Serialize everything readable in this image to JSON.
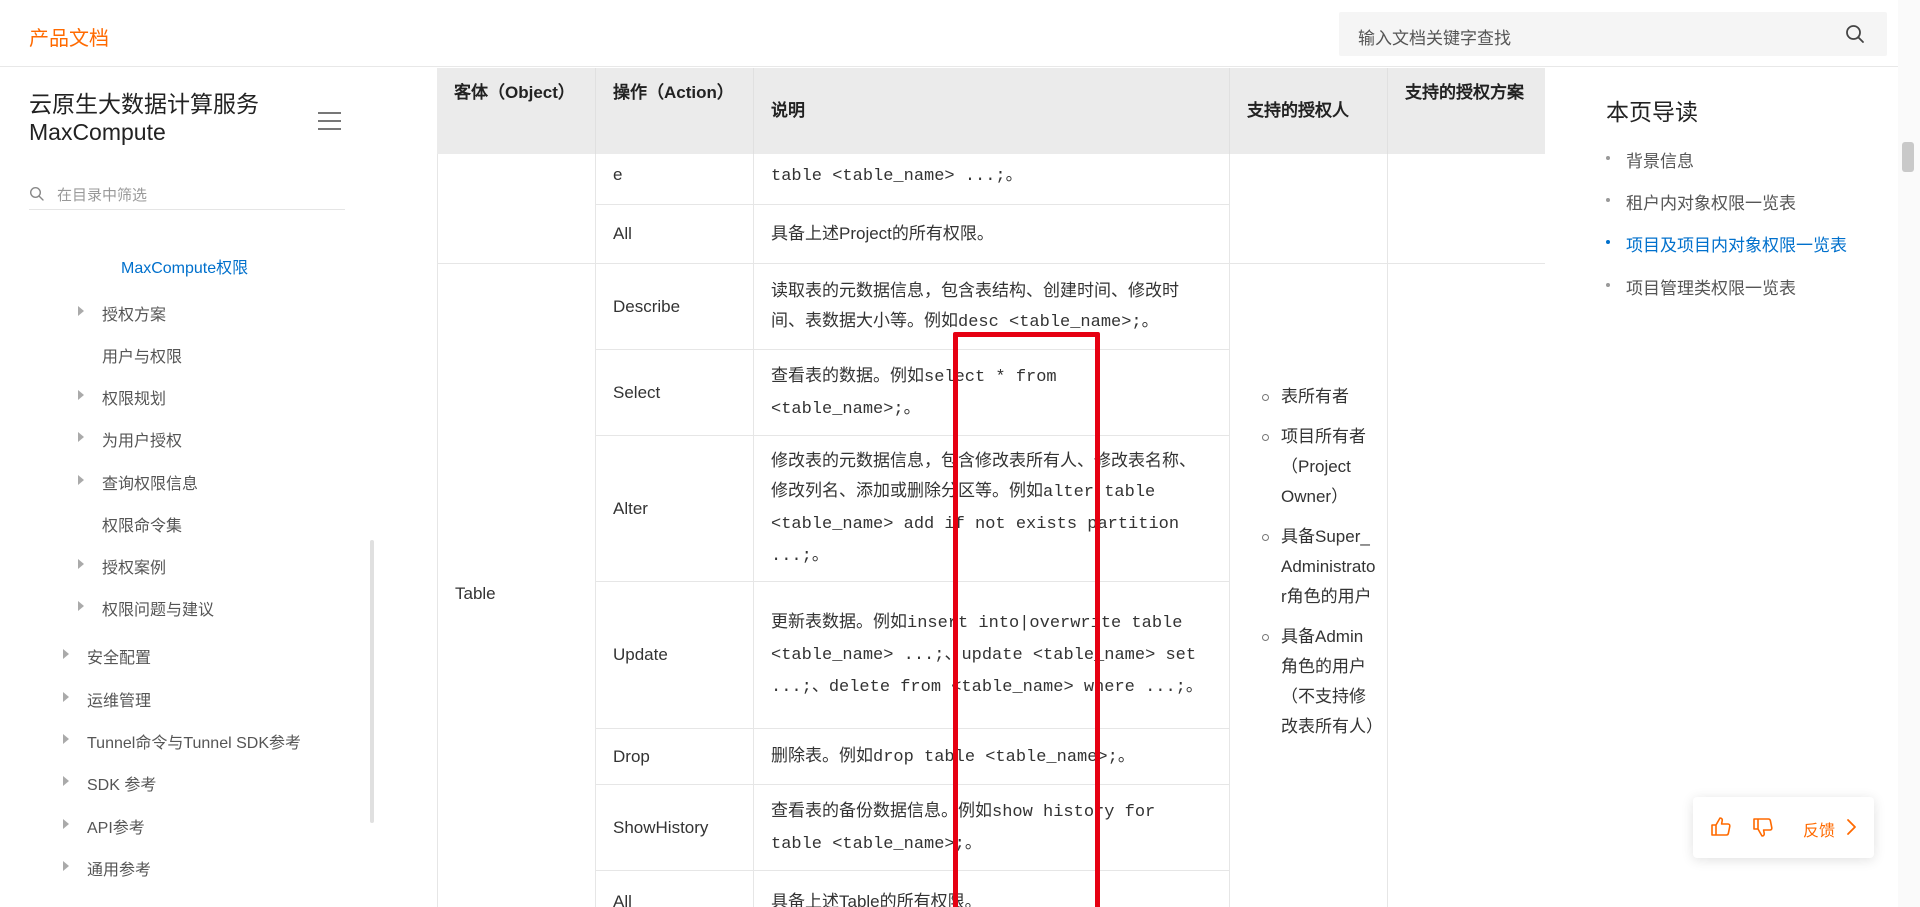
{
  "header": {
    "brand": "产品文档",
    "search_placeholder": "输入文档关键字查找"
  },
  "sidebar": {
    "title_line1": "云原生大数据计算服务",
    "title_line2": "MaxCompute",
    "filter_placeholder": "在目录中筛选",
    "items": [
      {
        "label": "MaxCompute权限",
        "active": true,
        "expandable": false
      },
      {
        "label": "授权方案",
        "active": false,
        "expandable": true
      },
      {
        "label": "用户与权限",
        "active": false,
        "expandable": false
      },
      {
        "label": "权限规划",
        "active": false,
        "expandable": true
      },
      {
        "label": "为用户授权",
        "active": false,
        "expandable": true
      },
      {
        "label": "查询权限信息",
        "active": false,
        "expandable": true
      },
      {
        "label": "权限命令集",
        "active": false,
        "expandable": false
      },
      {
        "label": "授权案例",
        "active": false,
        "expandable": true
      },
      {
        "label": "权限问题与建议",
        "active": false,
        "expandable": true
      },
      {
        "label": "安全配置",
        "active": false,
        "expandable": true
      },
      {
        "label": "运维管理",
        "active": false,
        "expandable": true
      },
      {
        "label": "Tunnel命令与Tunnel SDK参考",
        "active": false,
        "expandable": true
      },
      {
        "label": "SDK 参考",
        "active": false,
        "expandable": true
      },
      {
        "label": "API参考",
        "active": false,
        "expandable": true
      },
      {
        "label": "通用参考",
        "active": false,
        "expandable": true
      }
    ]
  },
  "table": {
    "headers": {
      "object": "客体（Object）",
      "action": "操作（Action）",
      "desc": "说明",
      "grantee": "支持的授权人",
      "scheme": "支持的授权方案"
    },
    "partial_row": {
      "action": "e",
      "desc_mono": "table <table_name> ...;",
      "desc_tail": "。"
    },
    "project_all": {
      "action": "All",
      "desc": "具备上述Project的所有权限。"
    },
    "table_object": "Table",
    "rows": [
      {
        "action": "Describe",
        "desc_text": "读取表的元数据信息，包含表结构、创建时间、修改时间、表数据大小等。例如",
        "desc_mono": "desc <table_name>;",
        "desc_tail": "。"
      },
      {
        "action": "Select",
        "desc_text": "查看表的数据。例如",
        "desc_mono": "select * from <table_name>;",
        "desc_tail": "。"
      },
      {
        "action": "Alter",
        "desc_text": "修改表的元数据信息，包含修改表所有人、修改表名称、修改列名、添加或删除分区等。例如",
        "desc_mono": "alter table <table_name> add if not exists partition ...;",
        "desc_tail": "。"
      },
      {
        "action": "Update",
        "desc_text": "更新表数据。例如",
        "desc_mono": "insert into|overwrite table <table_name> ...;",
        "desc_mid1": "、",
        "desc_mono2": "update <table_name> set ...;",
        "desc_mid2": "、",
        "desc_mono3": "delete from <table_name> where ...;",
        "desc_tail": "。"
      },
      {
        "action": "Drop",
        "desc_text": "删除表。例如",
        "desc_mono": "drop table <table_name>;",
        "desc_tail": "。"
      },
      {
        "action": "ShowHistory",
        "desc_text": "查看表的备份数据信息。例如",
        "desc_mono": "show history for table <table_name>;",
        "desc_tail": "。"
      },
      {
        "action": "All",
        "desc_text": "具备上述Table的所有权限。",
        "desc_mono": "",
        "desc_tail": ""
      }
    ],
    "grantees": [
      "表所有者",
      "项目所有者（Project Owner）",
      "具备Super_Administrator角色的用户",
      "具备Admin角色的用户（不支持修改表所有人）"
    ]
  },
  "toc": {
    "title": "本页导读",
    "items": [
      {
        "label": "背景信息",
        "active": false
      },
      {
        "label": "租户内对象权限一览表",
        "active": false
      },
      {
        "label": "项目及项目内对象权限一览表",
        "active": true
      },
      {
        "label": "项目管理类权限一览表",
        "active": false
      }
    ]
  },
  "feedback": {
    "label": "反馈"
  },
  "colors": {
    "accent": "#ff6a00",
    "link": "#0070cc",
    "highlight": "#e60012"
  }
}
